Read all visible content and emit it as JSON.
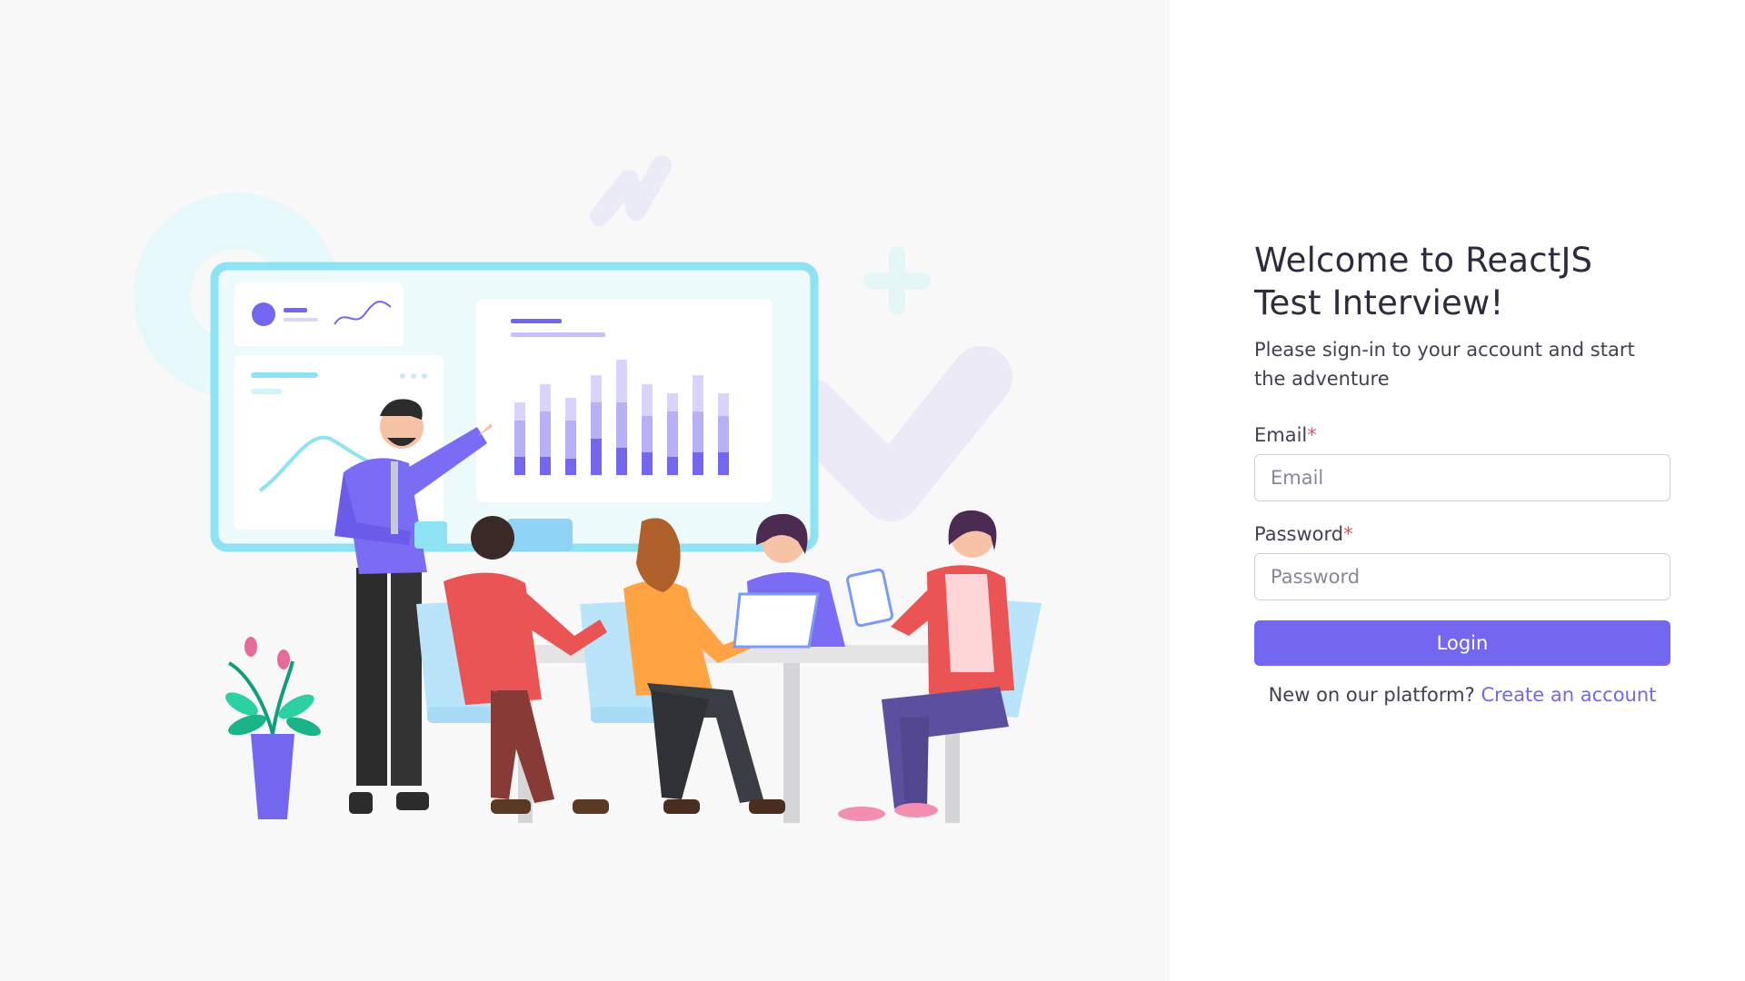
{
  "welcome": {
    "title_line1": "Welcome to ReactJS",
    "title_line2": "Test Interview!",
    "subtitle": "Please sign-in to your account and start the adventure"
  },
  "form": {
    "email_label": "Email",
    "email_placeholder": "Email",
    "password_label": "Password",
    "password_placeholder": "Password",
    "required_mark": "*",
    "login_label": "Login"
  },
  "signup": {
    "prompt": "New on our platform?",
    "link_text": "Create an account"
  },
  "colors": {
    "primary": "#7367f0",
    "required": "#ea5455",
    "illustration_background": "#f8f8f9",
    "screen_frame": "#8ee3f3"
  },
  "illustration": {
    "subject": "team-meeting-illustration",
    "icons": [
      "ring-decoration-icon",
      "zigzag-decoration-icon",
      "plus-decoration-icon",
      "checkmark-decoration-icon",
      "plant-icon"
    ]
  }
}
